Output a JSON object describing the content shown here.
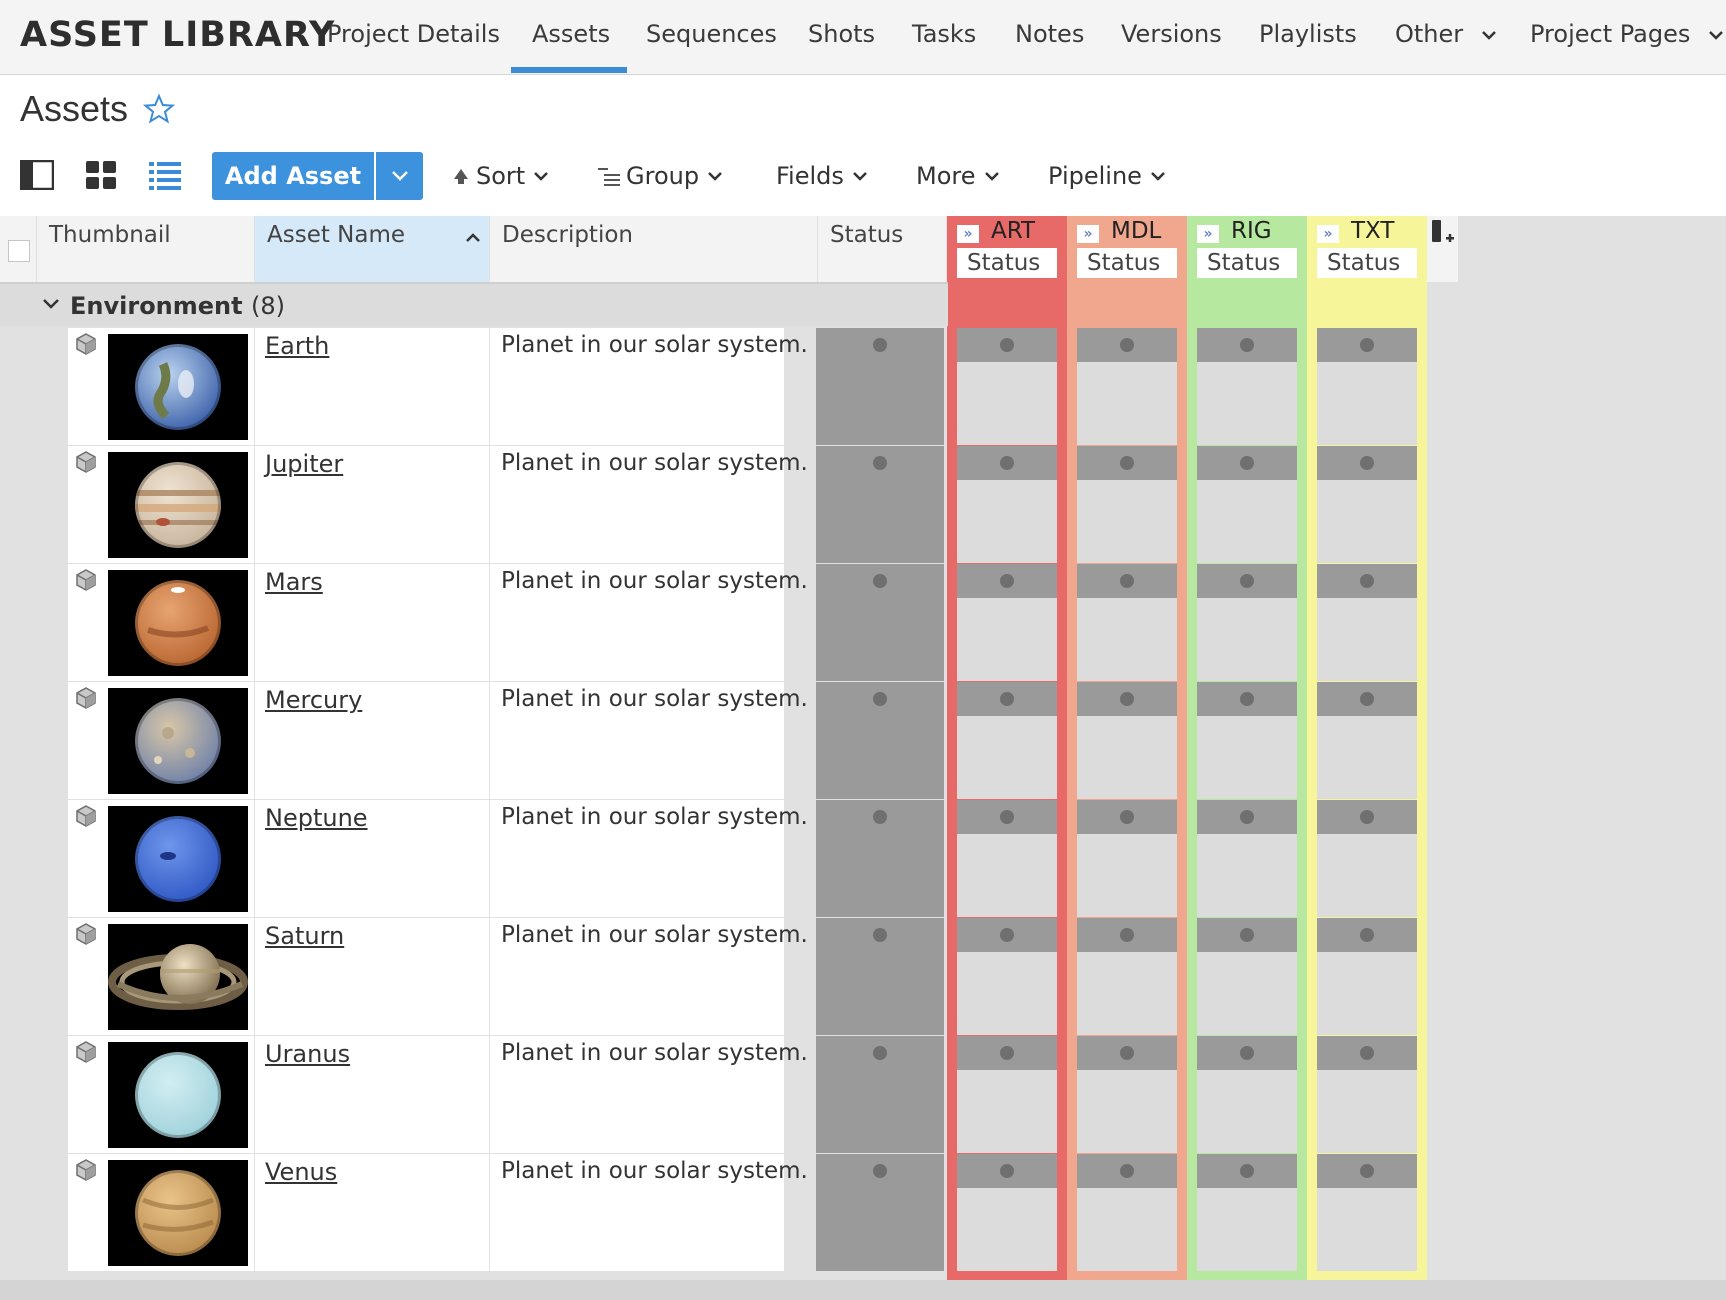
{
  "app": {
    "title": "ASSET LIBRARY"
  },
  "nav": {
    "items": [
      {
        "label": "Project Details"
      },
      {
        "label": "Assets"
      },
      {
        "label": "Sequences"
      },
      {
        "label": "Shots"
      },
      {
        "label": "Tasks"
      },
      {
        "label": "Notes"
      },
      {
        "label": "Versions"
      },
      {
        "label": "Playlists"
      },
      {
        "label": "Other"
      },
      {
        "label": "Project Pages"
      }
    ],
    "active": "Assets"
  },
  "page": {
    "title": "Assets"
  },
  "toolbar": {
    "add_label": "Add Asset",
    "sort_label": "Sort",
    "group_label": "Group",
    "fields_label": "Fields",
    "more_label": "More",
    "pipeline_label": "Pipeline"
  },
  "columns": {
    "thumbnail": "Thumbnail",
    "asset_name": "Asset Name",
    "description": "Description",
    "status": "Status"
  },
  "pipeline_steps": [
    {
      "name": "ART",
      "sub": "Status",
      "color": "#e86a68"
    },
    {
      "name": "MDL",
      "sub": "Status",
      "color": "#f0a78e"
    },
    {
      "name": "RIG",
      "sub": "Status",
      "color": "#b6e8a0"
    },
    {
      "name": "TXT",
      "sub": "Status",
      "color": "#f7f59a"
    }
  ],
  "group": {
    "label": "Environment",
    "count": "(8)"
  },
  "assets": [
    {
      "name": "Earth",
      "description": "Planet in our solar system."
    },
    {
      "name": "Jupiter",
      "description": "Planet in our solar system."
    },
    {
      "name": "Mars",
      "description": "Planet in our solar system."
    },
    {
      "name": "Mercury",
      "description": "Planet in our solar system."
    },
    {
      "name": "Neptune",
      "description": "Planet in our solar system."
    },
    {
      "name": "Saturn",
      "description": "Planet in our solar system."
    },
    {
      "name": "Uranus",
      "description": "Planet in our solar system."
    },
    {
      "name": "Venus",
      "description": "Planet in our solar system."
    }
  ]
}
